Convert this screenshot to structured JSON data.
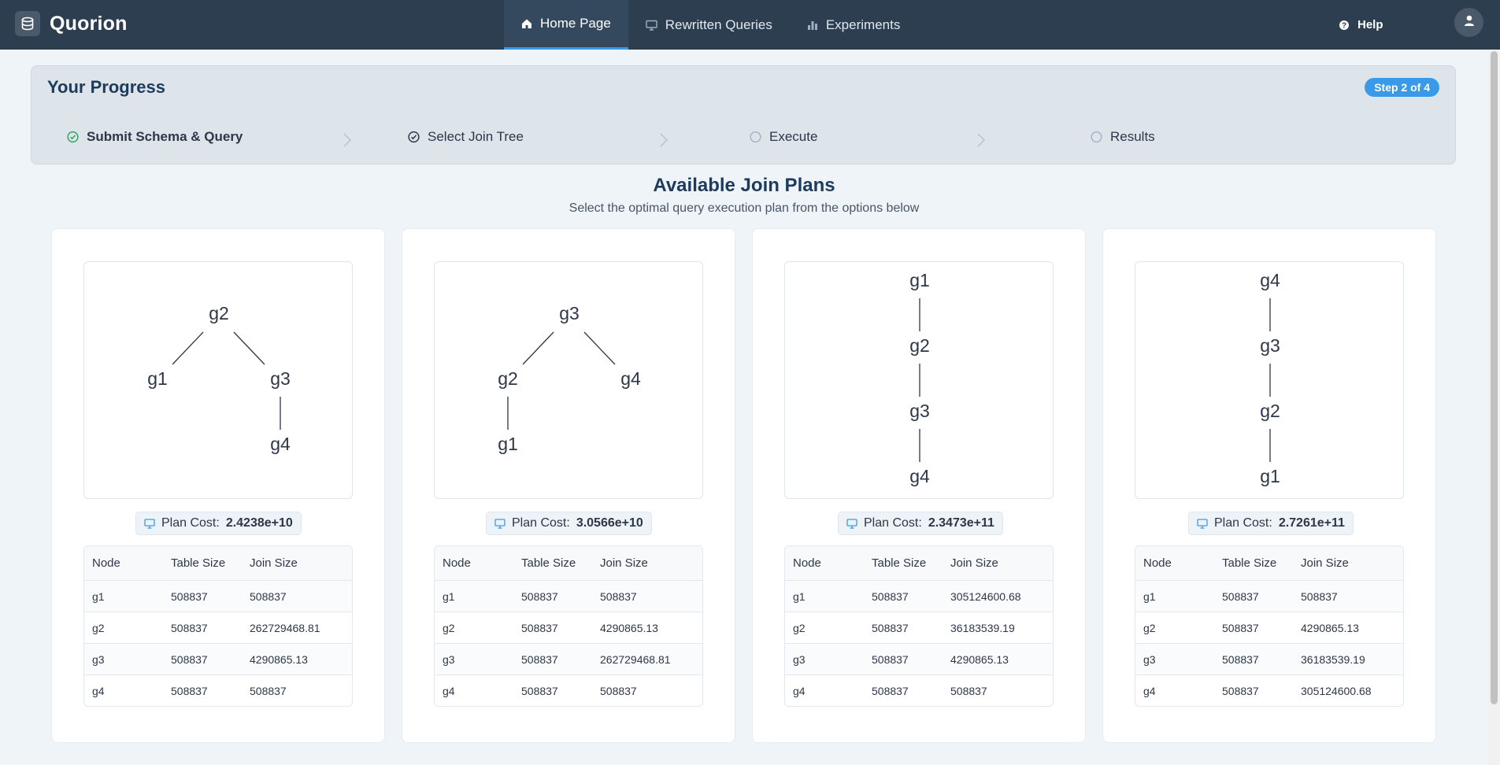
{
  "app": {
    "title": "Quorion",
    "logo_icon": "database-icon"
  },
  "nav": {
    "items": [
      {
        "label": "Home Page",
        "icon": "home-icon",
        "active": true
      },
      {
        "label": "Rewritten Queries",
        "icon": "monitor-icon",
        "active": false
      },
      {
        "label": "Experiments",
        "icon": "bar-chart-icon",
        "active": false
      }
    ],
    "help_label": "Help"
  },
  "progress": {
    "title": "Your Progress",
    "badge": "Step 2 of 4",
    "steps": [
      {
        "label": "Submit Schema & Query",
        "status": "done"
      },
      {
        "label": "Select Join Tree",
        "status": "current"
      },
      {
        "label": "Execute",
        "status": "pending"
      },
      {
        "label": "Results",
        "status": "pending"
      }
    ]
  },
  "plans_section": {
    "title": "Available Join Plans",
    "subtitle": "Select the optimal query execution plan from the options below"
  },
  "plans": [
    {
      "tree": {
        "root": "g2",
        "edges": [
          [
            "g2",
            "g1"
          ],
          [
            "g2",
            "g3"
          ],
          [
            "g3",
            "g4"
          ]
        ]
      },
      "cost_label": "Plan Cost:",
      "cost_value": "2.4238e+10",
      "columns": [
        "Node",
        "Table Size",
        "Join Size"
      ],
      "rows": [
        [
          "g1",
          "508837",
          "508837"
        ],
        [
          "g2",
          "508837",
          "262729468.81"
        ],
        [
          "g3",
          "508837",
          "4290865.13"
        ],
        [
          "g4",
          "508837",
          "508837"
        ]
      ]
    },
    {
      "tree": {
        "root": "g3",
        "edges": [
          [
            "g3",
            "g2"
          ],
          [
            "g3",
            "g4"
          ],
          [
            "g2",
            "g1"
          ]
        ]
      },
      "cost_label": "Plan Cost:",
      "cost_value": "3.0566e+10",
      "columns": [
        "Node",
        "Table Size",
        "Join Size"
      ],
      "rows": [
        [
          "g1",
          "508837",
          "508837"
        ],
        [
          "g2",
          "508837",
          "4290865.13"
        ],
        [
          "g3",
          "508837",
          "262729468.81"
        ],
        [
          "g4",
          "508837",
          "508837"
        ]
      ]
    },
    {
      "tree": {
        "root": "g1",
        "edges": [
          [
            "g1",
            "g2"
          ],
          [
            "g2",
            "g3"
          ],
          [
            "g3",
            "g4"
          ]
        ]
      },
      "cost_label": "Plan Cost:",
      "cost_value": "2.3473e+11",
      "columns": [
        "Node",
        "Table Size",
        "Join Size"
      ],
      "rows": [
        [
          "g1",
          "508837",
          "305124600.68"
        ],
        [
          "g2",
          "508837",
          "36183539.19"
        ],
        [
          "g3",
          "508837",
          "4290865.13"
        ],
        [
          "g4",
          "508837",
          "508837"
        ]
      ]
    },
    {
      "tree": {
        "root": "g4",
        "edges": [
          [
            "g4",
            "g3"
          ],
          [
            "g3",
            "g2"
          ],
          [
            "g2",
            "g1"
          ]
        ]
      },
      "cost_label": "Plan Cost:",
      "cost_value": "2.7261e+11",
      "columns": [
        "Node",
        "Table Size",
        "Join Size"
      ],
      "rows": [
        [
          "g1",
          "508837",
          "508837"
        ],
        [
          "g2",
          "508837",
          "4290865.13"
        ],
        [
          "g3",
          "508837",
          "36183539.19"
        ],
        [
          "g4",
          "508837",
          "305124600.68"
        ]
      ]
    }
  ],
  "colors": {
    "topbar": "#2c3e50",
    "accent": "#3b9ae8",
    "done": "#38a169"
  }
}
